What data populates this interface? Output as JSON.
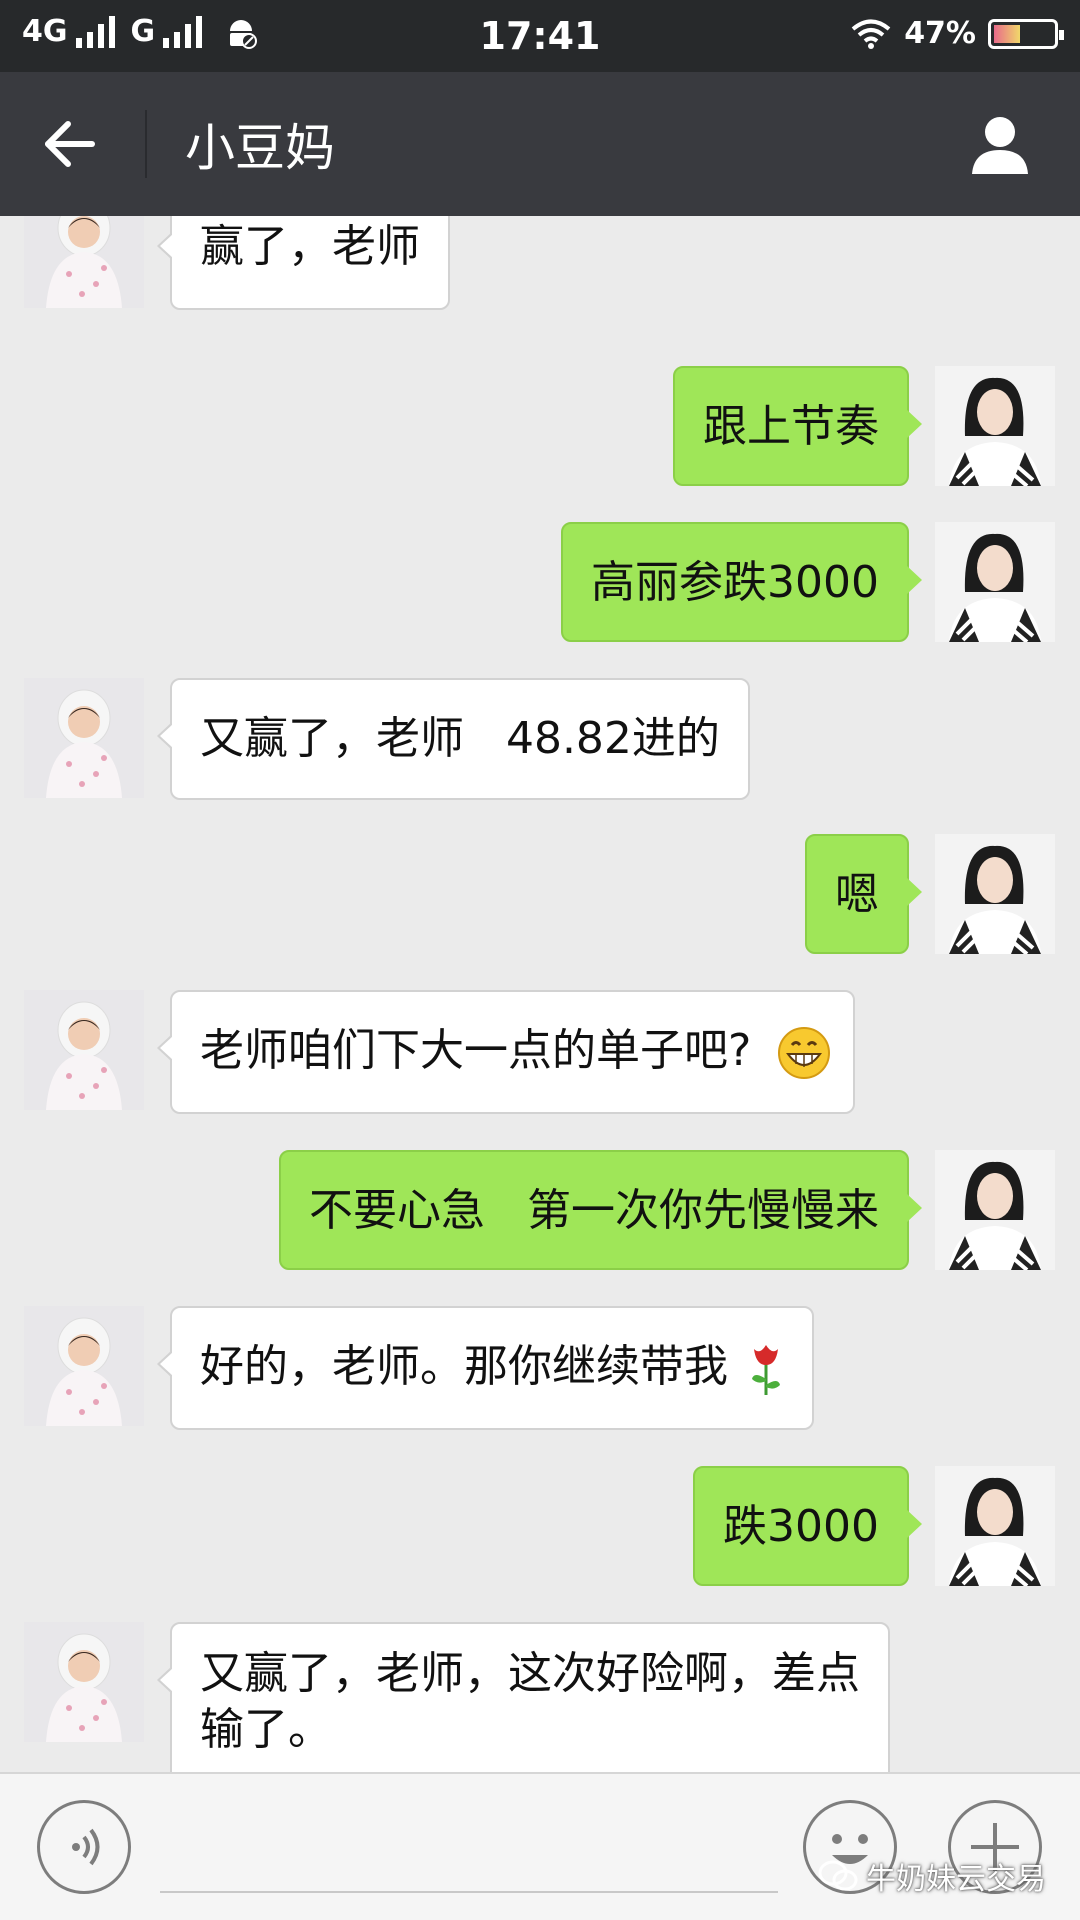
{
  "status_bar": {
    "network_1": "4G",
    "network_2": "G",
    "time": "17:41",
    "battery": "47%",
    "battery_level": 0.47
  },
  "header": {
    "title": "小豆妈",
    "back_icon": "arrow-left-icon",
    "profile_icon": "person-icon"
  },
  "messages": [
    {
      "side": "left",
      "text": "赢了，老师"
    },
    {
      "side": "right",
      "text": "跟上节奏"
    },
    {
      "side": "right",
      "text": "高丽参跌3000"
    },
    {
      "side": "left",
      "text": "又赢了，老师   48.82进的"
    },
    {
      "side": "right",
      "text": "嗯"
    },
    {
      "side": "left",
      "text": "老师咱们下大一点的单子吧?",
      "emoji": "grinning-face-icon"
    },
    {
      "side": "right",
      "text": "不要心急   第一次你先慢慢来"
    },
    {
      "side": "left",
      "text": "好的，老师。那你继续带我",
      "emoji": "rose-icon"
    },
    {
      "side": "right",
      "text": "跌3000"
    },
    {
      "side": "left",
      "text": "又赢了，老师，这次好险啊，差点\n输了。"
    }
  ],
  "input_bar": {
    "voice_icon": "voice-icon",
    "emoji_icon": "emoji-icon",
    "plus_icon": "plus-icon"
  },
  "watermark": "牛奶妹云交易",
  "colors": {
    "status_bar": "#27292b",
    "header": "#393a3f",
    "chat_bg": "#ebebeb",
    "sent_bubble": "#9fe658",
    "received_bubble": "#ffffff"
  }
}
